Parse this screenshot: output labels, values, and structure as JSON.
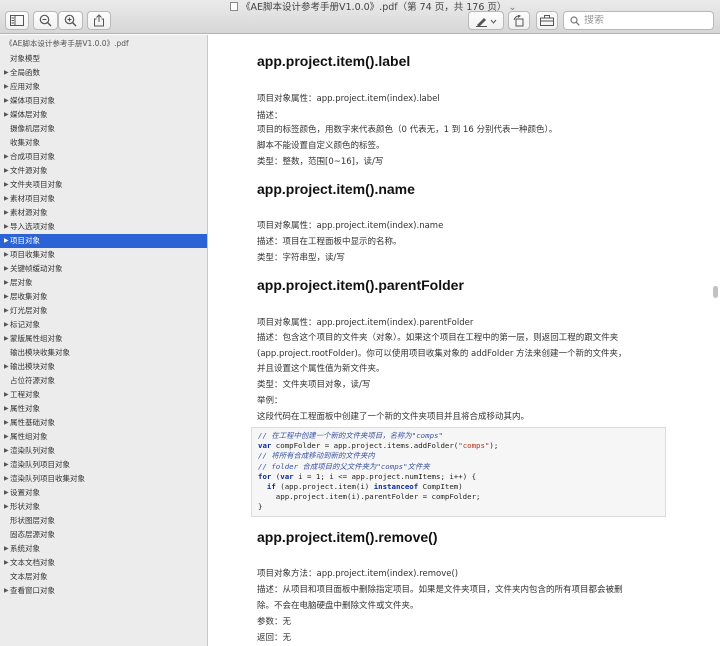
{
  "window": {
    "title": "《AE脚本设计参考手册V1.0.0》.pdf（第 74 页，共 176 页）",
    "title_suffix": "⌄"
  },
  "toolbar": {
    "search_placeholder": "搜索"
  },
  "sidebar": {
    "doc_title": "《AE脚本设计参考手册V1.0.0》.pdf",
    "items": [
      {
        "label": "对象模型",
        "arrow": "",
        "indent": 1
      },
      {
        "label": "全局函数",
        "arrow": "▶",
        "indent": 0
      },
      {
        "label": "应用对象",
        "arrow": "▶",
        "indent": 0
      },
      {
        "label": "媒体项目对象",
        "arrow": "▶",
        "indent": 0
      },
      {
        "label": "媒体层对象",
        "arrow": "▶",
        "indent": 0
      },
      {
        "label": "摄像机层对象",
        "arrow": "",
        "indent": 1
      },
      {
        "label": "收集对象",
        "arrow": "",
        "indent": 1
      },
      {
        "label": "合成项目对象",
        "arrow": "▶",
        "indent": 0
      },
      {
        "label": "文件源对象",
        "arrow": "▶",
        "indent": 0
      },
      {
        "label": "文件夹项目对象",
        "arrow": "▶",
        "indent": 0
      },
      {
        "label": "素材项目对象",
        "arrow": "▶",
        "indent": 0
      },
      {
        "label": "素材源对象",
        "arrow": "▶",
        "indent": 0
      },
      {
        "label": "导入选项对象",
        "arrow": "▶",
        "indent": 0
      },
      {
        "label": "项目对象",
        "arrow": "▶",
        "indent": 0,
        "selected": true
      },
      {
        "label": "项目收集对象",
        "arrow": "▶",
        "indent": 0
      },
      {
        "label": "关键帧缓动对象",
        "arrow": "▶",
        "indent": 0
      },
      {
        "label": "层对象",
        "arrow": "▶",
        "indent": 0
      },
      {
        "label": "层收集对象",
        "arrow": "▶",
        "indent": 0
      },
      {
        "label": "灯光层对象",
        "arrow": "▶",
        "indent": 0
      },
      {
        "label": "标记对象",
        "arrow": "▶",
        "indent": 0
      },
      {
        "label": "蒙版属性组对象",
        "arrow": "▶",
        "indent": 0
      },
      {
        "label": "输出模块收集对象",
        "arrow": "",
        "indent": 1
      },
      {
        "label": "输出模块对象",
        "arrow": "▶",
        "indent": 0
      },
      {
        "label": "占位符源对象",
        "arrow": "",
        "indent": 1
      },
      {
        "label": "工程对象",
        "arrow": "▶",
        "indent": 0
      },
      {
        "label": "属性对象",
        "arrow": "▶",
        "indent": 0
      },
      {
        "label": "属性基础对象",
        "arrow": "▶",
        "indent": 0
      },
      {
        "label": "属性组对象",
        "arrow": "▶",
        "indent": 0
      },
      {
        "label": "渲染队列对象",
        "arrow": "▶",
        "indent": 0
      },
      {
        "label": "渲染队列项目对象",
        "arrow": "▶",
        "indent": 0
      },
      {
        "label": "渲染队列项目收集对象",
        "arrow": "▶",
        "indent": 0
      },
      {
        "label": "设置对象",
        "arrow": "▶",
        "indent": 0
      },
      {
        "label": "形状对象",
        "arrow": "▶",
        "indent": 0
      },
      {
        "label": "形状图层对象",
        "arrow": "",
        "indent": 1
      },
      {
        "label": "固态层源对象",
        "arrow": "",
        "indent": 1
      },
      {
        "label": "系统对象",
        "arrow": "▶",
        "indent": 0
      },
      {
        "label": "文本文档对象",
        "arrow": "▶",
        "indent": 0
      },
      {
        "label": "文本层对象",
        "arrow": "",
        "indent": 1
      },
      {
        "label": "查看窗口对象",
        "arrow": "▶",
        "indent": 0
      }
    ]
  },
  "content": {
    "sections": [
      {
        "heading": "app.project.item().label",
        "lines": [
          "项目对象属性：app.project.item(index).label",
          "描述：",
          "项目的标签颜色，用数字来代表颜色（0 代表无，1 到 16 分别代表一种颜色）。",
          "脚本不能设置自定义颜色的标签。",
          "类型：整数，范围[0~16]，读/写"
        ]
      },
      {
        "heading": "app.project.item().name",
        "lines": [
          "项目对象属性：app.project.item(index).name",
          "描述：项目在工程面板中显示的名称。",
          "类型：字符串型，读/写"
        ]
      },
      {
        "heading": "app.project.item().parentFolder",
        "lines": [
          "项目对象属性：app.project.item(index).parentFolder",
          "描述：包含这个项目的文件夹（对象）。如果这个项目在工程中的第一层，则返回工程的跟文件夹",
          "(app.project.rootFolder)。你可以使用项目收集对象的 addFolder 方法来创建一个新的文件夹，",
          "并且设置这个属性值为新文件夹。",
          "类型：文件夹项目对象，读/写",
          "举例：",
          "这段代码在工程面板中创建了一个新的文件夹项目并且将合成移动其内。"
        ]
      },
      {
        "heading": "app.project.item().remove()",
        "lines": [
          "项目对象方法：app.project.item(index).remove()",
          "描述：从项目和项目面板中删除指定项目。如果是文件夹项目，文件夹内包含的所有项目都会被删",
          "除。不会在电脑硬盘中删除文件或文件夹。",
          "参数：无",
          "返回：无"
        ]
      }
    ],
    "code": {
      "comment1": "// 在工程中创建一个新的文件夹项目，名称为\"comps\"",
      "line2_kw": "var",
      "line2_a": " compFolder = app.project.items.addFolder(",
      "line2_str": "\"comps\"",
      "line2_b": ");",
      "comment3": "// 将所有合成移动到新的文件夹内",
      "comment4": "// folder 合成项目的父文件夹为\"comps\"文件夹",
      "line5_kw": "for",
      "line5_a": " (",
      "line5_kw2": "var",
      "line5_b": " i = 1; i <= app.project.numItems; i++) {",
      "line6_a": "  ",
      "line6_kw": "if",
      "line6_b": " (app.project.item(i) ",
      "line6_kw2": "instanceof",
      "line6_c": " CompItem)",
      "line7": "    app.project.item(i).parentFolder = compFolder;",
      "line8": "}"
    }
  },
  "colors": {
    "selection": "#2b63d6",
    "sidebar_bg": "#ececec",
    "code_comment": "#3a53a4",
    "code_keyword": "#0b2c9e",
    "code_string": "#b0331c"
  }
}
